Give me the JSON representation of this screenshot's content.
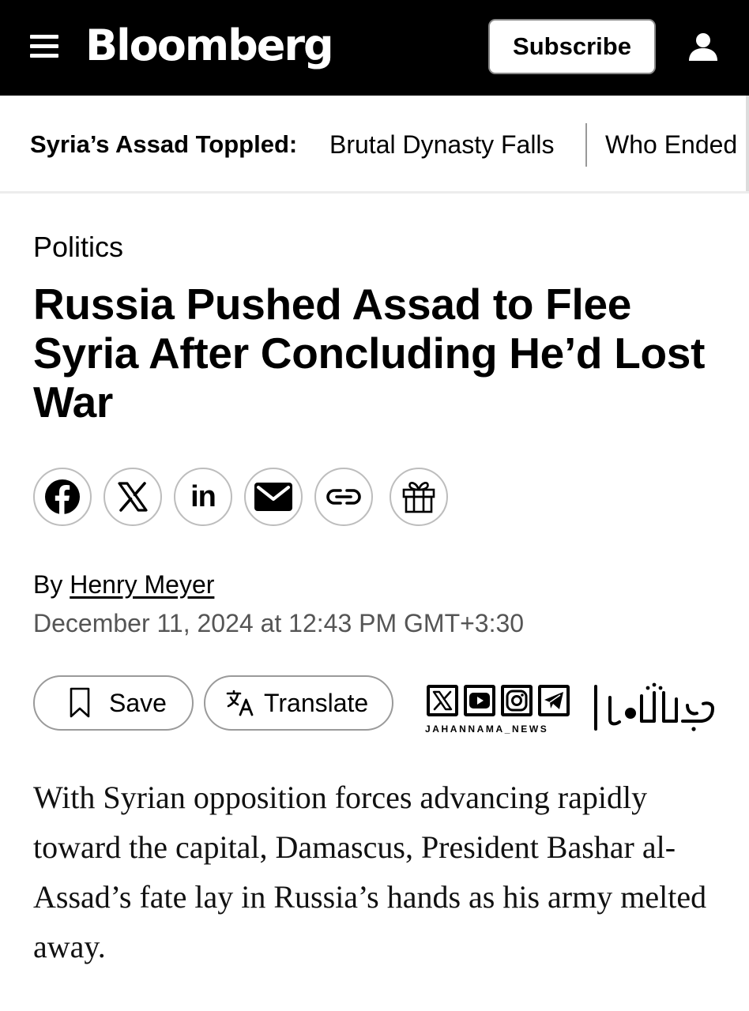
{
  "header": {
    "logo": "Bloomberg",
    "subscribe_label": "Subscribe",
    "menu_icon": "hamburger-menu-icon",
    "account_icon": "user-account-icon",
    "background_color": "#000000"
  },
  "ticker": {
    "label": "Syria’s Assad Toppled:",
    "items": [
      "Brutal Dynasty Falls",
      "Who Ended"
    ]
  },
  "article": {
    "category": "Politics",
    "headline": "Russia Pushed Assad to Flee Syria After Concluding He’d Lost War",
    "share_icons": [
      "facebook-icon",
      "x-icon",
      "linkedin-icon",
      "email-icon",
      "link-icon",
      "gift-icon"
    ],
    "linkedin_glyph": "in",
    "byline_prefix": "By",
    "author": "Henry Meyer",
    "date": "December 11, 2024 at 12:43 PM GMT+3:30",
    "actions": {
      "save_label": "Save",
      "translate_label": "Translate"
    },
    "body": "With Syrian opposition forces advancing rapidly toward the capital, Damascus, President Bashar al-Assad’s fate lay in Russia’s hands as his army melted away."
  },
  "watermark": {
    "handle": "JAHANNAMA_NEWS",
    "icons": [
      "x-icon",
      "youtube-icon",
      "instagram-icon",
      "telegram-icon"
    ]
  }
}
